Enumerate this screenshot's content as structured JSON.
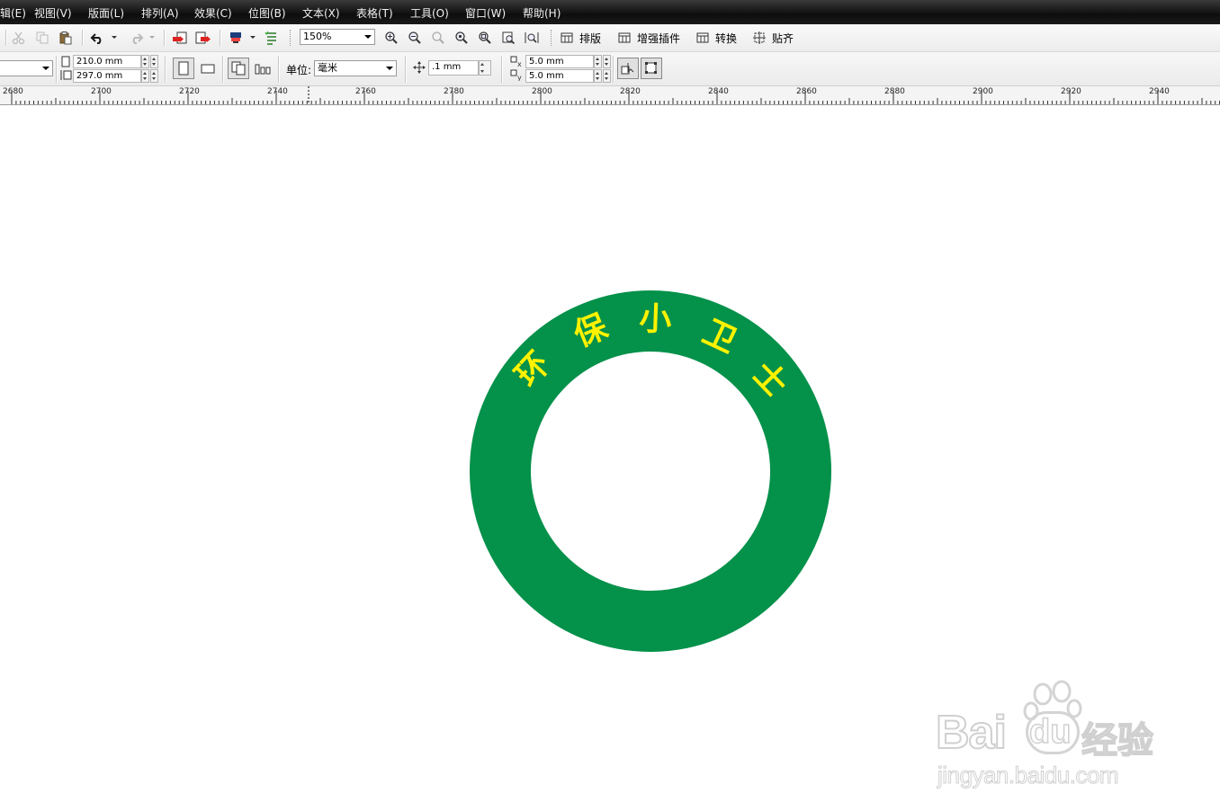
{
  "menu": [
    "编辑(E)",
    "视图(V)",
    "版面(L)",
    "排列(A)",
    "效果(C)",
    "位图(B)",
    "文本(X)",
    "表格(T)",
    "工具(O)",
    "窗口(W)",
    "帮助(H)"
  ],
  "toolbar": {
    "zoom_value": "150%",
    "plugin_buttons": [
      "排版",
      "增强插件",
      "转换",
      "贴齐"
    ]
  },
  "property_bar": {
    "page_width": "210.0 mm",
    "page_height": "297.0 mm",
    "unit_label": "单位:",
    "unit_value": "毫米",
    "nudge_value": ".1 mm",
    "dup_x": "5.0 mm",
    "dup_y": "5.0 mm"
  },
  "ruler": {
    "labels": [
      "2680",
      "2700",
      "2720",
      "2740",
      "2760",
      "2780",
      "2800",
      "2820",
      "2840",
      "2860",
      "2880",
      "2900",
      "2920",
      "2940"
    ]
  },
  "artwork": {
    "ring_color": "#04914A",
    "text_color": "#FFF200",
    "arc_text": [
      "环",
      "保",
      "小",
      "卫",
      "士"
    ]
  },
  "watermark": {
    "brand": "Bai",
    "brand2": "du",
    "suffix": "经验",
    "url": "jingyan.baidu.com"
  }
}
